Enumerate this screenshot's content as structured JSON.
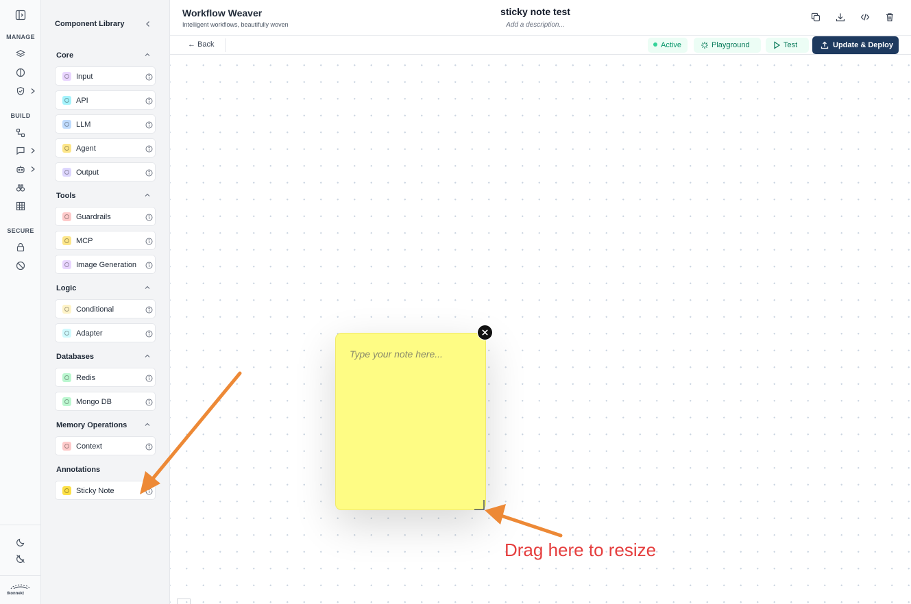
{
  "rail": {
    "sections": [
      "MANAGE",
      "BUILD",
      "SECURE"
    ],
    "logo_text": "tkonnekt"
  },
  "library": {
    "title": "Component Library",
    "groups": [
      {
        "title": "Core",
        "items": [
          {
            "label": "Input",
            "color": "#e9d5ff"
          },
          {
            "label": "API",
            "color": "#a5f3fc"
          },
          {
            "label": "LLM",
            "color": "#bfdbfe"
          },
          {
            "label": "Agent",
            "color": "#fde68a"
          },
          {
            "label": "Output",
            "color": "#ddd6fe"
          }
        ]
      },
      {
        "title": "Tools",
        "items": [
          {
            "label": "Guardrails",
            "color": "#fecaca"
          },
          {
            "label": "MCP",
            "color": "#fde68a"
          },
          {
            "label": "Image Generation",
            "color": "#e9d5ff"
          }
        ]
      },
      {
        "title": "Logic",
        "items": [
          {
            "label": "Conditional",
            "color": "#fef3c7"
          },
          {
            "label": "Adapter",
            "color": "#cffafe"
          }
        ]
      },
      {
        "title": "Databases",
        "items": [
          {
            "label": "Redis",
            "color": "#bbf7d0"
          },
          {
            "label": "Mongo DB",
            "color": "#bbf7d0"
          }
        ]
      },
      {
        "title": "Memory Operations",
        "items": [
          {
            "label": "Context",
            "color": "#fecaca"
          }
        ]
      },
      {
        "title": "Annotations",
        "items": [
          {
            "label": "Sticky Note",
            "color": "#fde047"
          }
        ]
      }
    ]
  },
  "header": {
    "app_title": "Workflow Weaver",
    "app_subtitle": "Intelligent workflows, beautifully woven",
    "workflow_title": "sticky note test",
    "workflow_description": "Add a description..."
  },
  "toolbar": {
    "back_label": "← Back",
    "status": "Active",
    "playground_label": "Playground",
    "test_label": "Test",
    "deploy_label": "Update & Deploy"
  },
  "canvas": {
    "note_placeholder": "Type your note here...",
    "annotation_text": "Drag here to resize"
  },
  "colors": {
    "note": "#fefc84",
    "deploy": "#1e3a5f",
    "active": "#059669",
    "arrow": "#ed8936",
    "annotation": "#e53e3e"
  }
}
